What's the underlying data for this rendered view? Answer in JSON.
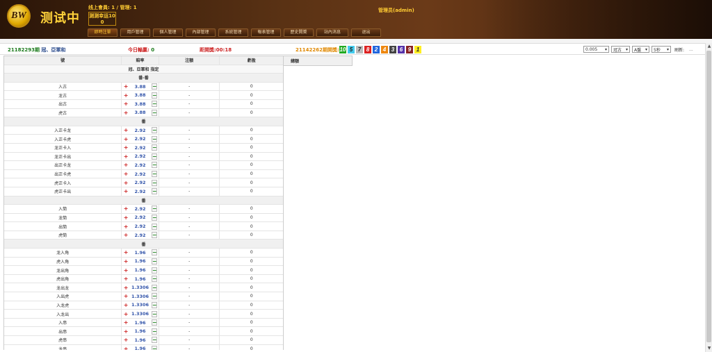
{
  "header": {
    "logo_text": "BW",
    "app_title": "测试中",
    "online_status": "线上會員: 1 / 管理: 1",
    "lucky_label": "测测幸运10",
    "lucky_value": "0",
    "admin_user": "管理员(admin)"
  },
  "nav": {
    "items": [
      "即時注單",
      "用戶管理",
      "個人管理",
      "內部管理",
      "系統管理",
      "報表管理",
      "歷史開獎",
      "站內消息",
      "退出"
    ]
  },
  "infobar": {
    "period_number": "21182293期",
    "period_suffix": "冠、亞軍和",
    "today_label": "今日輸贏:",
    "today_value": "0",
    "countdown": "距開獎:00:18",
    "last_draw_label": "21142262期開獎:",
    "balls": [
      {
        "n": "10",
        "color": "#22aa22"
      },
      {
        "n": "5",
        "color": "#44ccee"
      },
      {
        "n": "7",
        "color": "#bbbbbb"
      },
      {
        "n": "8",
        "color": "#dd2222"
      },
      {
        "n": "2",
        "color": "#2266dd"
      },
      {
        "n": "4",
        "color": "#ee8811"
      },
      {
        "n": "3",
        "color": "#444444"
      },
      {
        "n": "6",
        "color": "#5533aa"
      },
      {
        "n": "9",
        "color": "#882222"
      },
      {
        "n": "1",
        "color": "#ffee22"
      }
    ],
    "select_amount": "0.005",
    "select_type": "冠古",
    "select_plate": "A盤",
    "select_interval": "5秒",
    "refresh_label": "刷新:",
    "refresh_value": "..."
  },
  "table": {
    "headers": [
      "號",
      "賠率",
      "注額",
      "虧盈"
    ],
    "subtitle": "冠、亞軍和 指定",
    "side_header": "總額",
    "sections": [
      {
        "title": "番-番",
        "rows": [
          {
            "label": "入古",
            "odds": "3.88",
            "amount": "-",
            "pl": "0"
          },
          {
            "label": "龙古",
            "odds": "3.88",
            "amount": "-",
            "pl": "0"
          },
          {
            "label": "出古",
            "odds": "3.88",
            "amount": "-",
            "pl": "0"
          },
          {
            "label": "虎古",
            "odds": "3.88",
            "amount": "-",
            "pl": "0"
          }
        ]
      },
      {
        "title": "番",
        "rows": [
          {
            "label": "入正卡龙",
            "odds": "2.92",
            "amount": "-",
            "pl": "0"
          },
          {
            "label": "入正卡虎",
            "odds": "2.92",
            "amount": "-",
            "pl": "0"
          },
          {
            "label": "龙正卡入",
            "odds": "2.92",
            "amount": "-",
            "pl": "0"
          },
          {
            "label": "龙正卡出",
            "odds": "2.92",
            "amount": "-",
            "pl": "0"
          },
          {
            "label": "出正卡龙",
            "odds": "2.92",
            "amount": "-",
            "pl": "0"
          },
          {
            "label": "出正卡虎",
            "odds": "2.92",
            "amount": "-",
            "pl": "0"
          },
          {
            "label": "虎正卡入",
            "odds": "2.92",
            "amount": "-",
            "pl": "0"
          },
          {
            "label": "虎正卡出",
            "odds": "2.92",
            "amount": "-",
            "pl": "0"
          }
        ]
      },
      {
        "title": "番",
        "rows": [
          {
            "label": "入筒",
            "odds": "2.92",
            "amount": "-",
            "pl": "0"
          },
          {
            "label": "龙筒",
            "odds": "2.92",
            "amount": "-",
            "pl": "0"
          },
          {
            "label": "出筒",
            "odds": "2.92",
            "amount": "-",
            "pl": "0"
          },
          {
            "label": "虎筒",
            "odds": "2.92",
            "amount": "-",
            "pl": "0"
          }
        ]
      },
      {
        "title": "番",
        "rows": [
          {
            "label": "龙入角",
            "odds": "1.96",
            "amount": "-",
            "pl": "0"
          },
          {
            "label": "虎入角",
            "odds": "1.96",
            "amount": "-",
            "pl": "0"
          },
          {
            "label": "龙出角",
            "odds": "1.96",
            "amount": "-",
            "pl": "0"
          },
          {
            "label": "虎出角",
            "odds": "1.96",
            "amount": "-",
            "pl": "0"
          },
          {
            "label": "龙出龙",
            "odds": "1.3306",
            "amount": "-",
            "pl": "0"
          },
          {
            "label": "入出虎",
            "odds": "1.3306",
            "amount": "-",
            "pl": "0"
          },
          {
            "label": "入龙虎",
            "odds": "1.3306",
            "amount": "-",
            "pl": "0"
          },
          {
            "label": "入龙出",
            "odds": "1.3306",
            "amount": "-",
            "pl": "0"
          },
          {
            "label": "入串",
            "odds": "1.96",
            "amount": "-",
            "pl": "0"
          },
          {
            "label": "出串",
            "odds": "1.96",
            "amount": "-",
            "pl": "0"
          },
          {
            "label": "虎串",
            "odds": "1.96",
            "amount": "-",
            "pl": "0"
          },
          {
            "label": "龙串",
            "odds": "1.96",
            "amount": "-",
            "pl": "0"
          }
        ]
      }
    ]
  }
}
